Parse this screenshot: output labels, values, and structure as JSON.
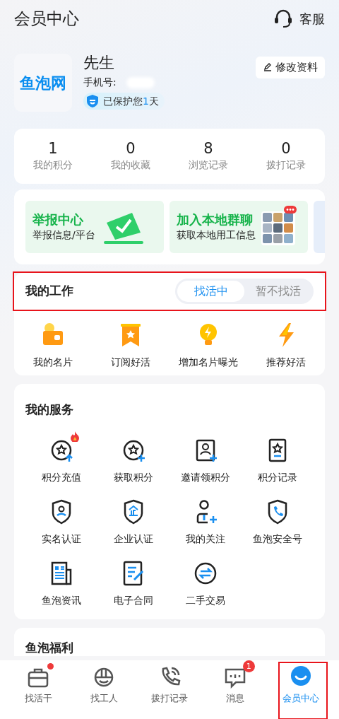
{
  "header": {
    "title": "会员中心",
    "service_label": "客服"
  },
  "profile": {
    "logo_text": "鱼泡网",
    "name": "先生",
    "phone_label": "手机号:",
    "protection_prefix": "已保护您",
    "protection_days": "1",
    "protection_suffix": "天",
    "edit_button": "修改资料"
  },
  "stats": [
    {
      "value": "1",
      "label": "我的积分"
    },
    {
      "value": "0",
      "label": "我的收藏"
    },
    {
      "value": "8",
      "label": "浏览记录"
    },
    {
      "value": "0",
      "label": "拨打记录"
    }
  ],
  "banners": [
    {
      "title": "举报中心",
      "subtitle": "举报信息/平台",
      "kind": "check"
    },
    {
      "title": "加入本地群聊",
      "subtitle": "获取本地用工信息",
      "kind": "photos"
    }
  ],
  "work": {
    "title": "我的工作",
    "toggle": [
      {
        "label": "找活中",
        "selected": true
      },
      {
        "label": "暂不找活",
        "selected": false
      }
    ],
    "items": [
      {
        "label": "我的名片",
        "kind": "card"
      },
      {
        "label": "订阅好活",
        "kind": "ribbon"
      },
      {
        "label": "增加名片曝光",
        "kind": "bulb"
      },
      {
        "label": "推荐好活",
        "kind": "bolt"
      }
    ]
  },
  "services": {
    "title": "我的服务",
    "items": [
      {
        "label": "积分充值",
        "kind": "coinup",
        "hot": true
      },
      {
        "label": "获取积分",
        "kind": "coinplus",
        "hot": false
      },
      {
        "label": "邀请领积分",
        "kind": "invite",
        "hot": false
      },
      {
        "label": "积分记录",
        "kind": "record",
        "hot": false
      },
      {
        "label": "实名认证",
        "kind": "realname",
        "hot": false
      },
      {
        "label": "企业认证",
        "kind": "company",
        "hot": false
      },
      {
        "label": "我的关注",
        "kind": "follow",
        "hot": false
      },
      {
        "label": "鱼泡安全号",
        "kind": "safephone",
        "hot": false
      },
      {
        "label": "鱼泡资讯",
        "kind": "news",
        "hot": false
      },
      {
        "label": "电子合同",
        "kind": "contract",
        "hot": false
      },
      {
        "label": "二手交易",
        "kind": "exchange",
        "hot": false
      }
    ]
  },
  "welfare": {
    "title": "鱼泡福利"
  },
  "tab_bar": [
    {
      "label": "找活干",
      "kind": "jobs",
      "selected": false,
      "dot": true
    },
    {
      "label": "找工人",
      "kind": "workers",
      "selected": false,
      "dot": false
    },
    {
      "label": "拨打记录",
      "kind": "calls",
      "selected": false,
      "dot": false
    },
    {
      "label": "消息",
      "kind": "messages",
      "selected": false,
      "dot": false,
      "badge": "1"
    },
    {
      "label": "会员中心",
      "kind": "member",
      "selected": true,
      "dot": false
    }
  ]
}
